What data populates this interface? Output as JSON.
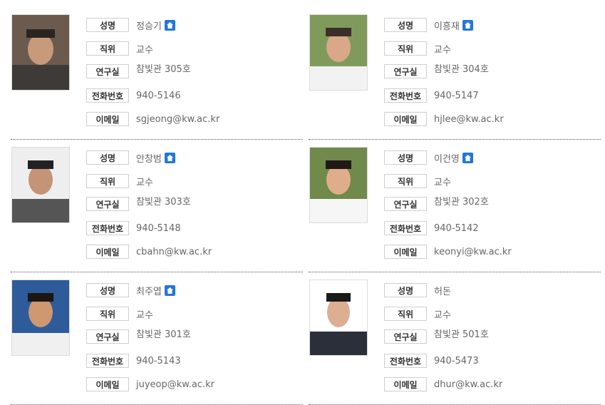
{
  "labels": {
    "name": "성명",
    "position": "직위",
    "office": "연구실",
    "phone": "전화번호",
    "email": "이메일"
  },
  "faculty": [
    {
      "name": "정승기",
      "position": "교수",
      "office": "참빛관 305호",
      "phone": "940-5146",
      "email": "sgjeong@kw.ac.kr",
      "has_homepage": true
    },
    {
      "name": "이흥재",
      "position": "교수",
      "office": "참빛관 304호",
      "phone": "940-5147",
      "email": "hjlee@kw.ac.kr",
      "has_homepage": true
    },
    {
      "name": "안창범",
      "position": "교수",
      "office": "참빛관 303호",
      "phone": "940-5148",
      "email": "cbahn@kw.ac.kr",
      "has_homepage": true
    },
    {
      "name": "이건영",
      "position": "교수",
      "office": "참빛관 302호",
      "phone": "940-5142",
      "email": "keonyi@kw.ac.kr",
      "has_homepage": true
    },
    {
      "name": "최주엽",
      "position": "교수",
      "office": "참빛관 301호",
      "phone": "940-5143",
      "email": "juyeop@kw.ac.kr",
      "has_homepage": true
    },
    {
      "name": "허돈",
      "position": "교수",
      "office": "참빛관 501호",
      "phone": "940-5473",
      "email": "dhur@kw.ac.kr",
      "has_homepage": false
    }
  ],
  "colors": {
    "homepage_icon": "#2178d8",
    "separator": "#555555",
    "label_border": "#cfcfcf"
  },
  "icons": {
    "homepage": "home-icon"
  }
}
